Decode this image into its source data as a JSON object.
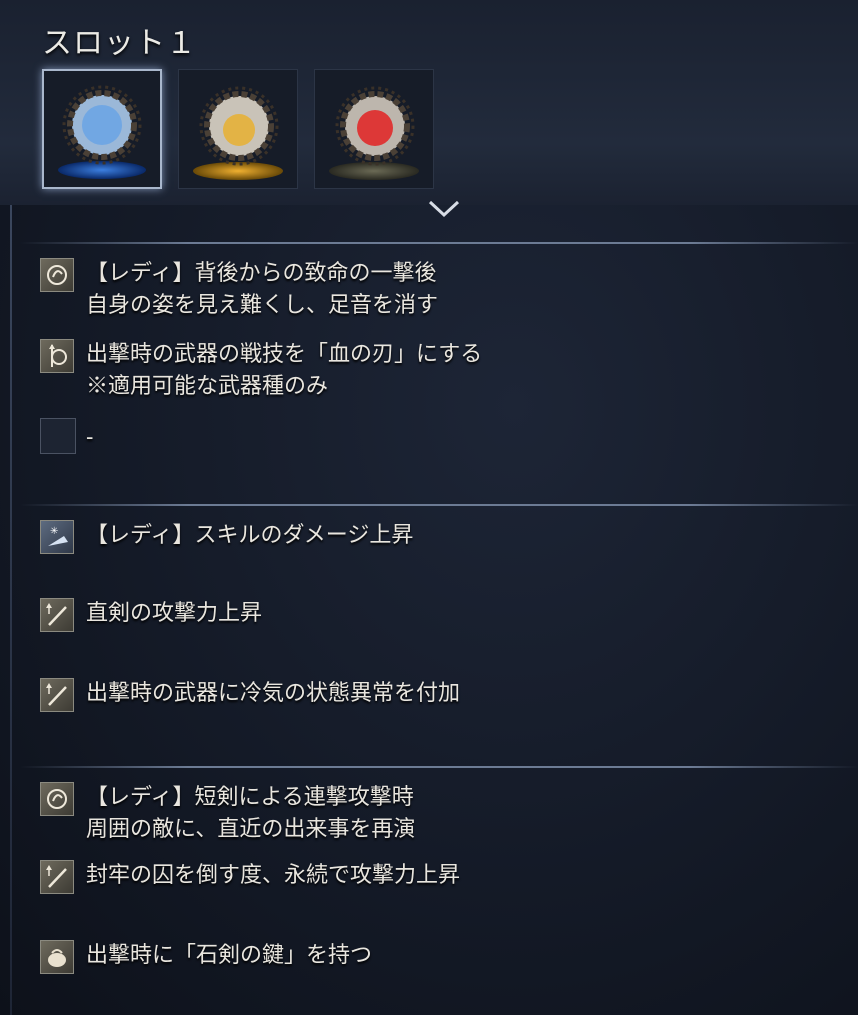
{
  "slot": {
    "title": "スロット１"
  },
  "vessels": [
    {
      "name": "blue-vessel-icon",
      "color": "#5fa0e8",
      "selected": true
    },
    {
      "name": "yellow-vessel-icon",
      "color": "#e8b030",
      "selected": false
    },
    {
      "name": "red-vessel-icon",
      "color": "#e02a2a",
      "selected": false
    }
  ],
  "groups": [
    {
      "effects": [
        {
          "icon": "relic-ring-icon",
          "line1": "【レディ】背後からの致命の一撃後",
          "line2": "自身の姿を見え難くし、足音を消す"
        },
        {
          "icon": "weapon-art-icon",
          "line1": "出撃時の武器の戦技を「血の刃」にする",
          "line2": "※適用可能な武器種のみ"
        },
        {
          "icon": "empty-slot",
          "line1": "-",
          "line2": ""
        }
      ]
    },
    {
      "effects": [
        {
          "icon": "skill-up-icon",
          "line1": "【レディ】スキルのダメージ上昇",
          "line2": ""
        },
        {
          "icon": "sword-up-icon",
          "line1": "直剣の攻撃力上昇",
          "line2": ""
        },
        {
          "icon": "sword-up-icon",
          "line1": "出撃時の武器に冷気の状態異常を付加",
          "line2": ""
        }
      ]
    },
    {
      "effects": [
        {
          "icon": "relic-ring-icon",
          "line1": "【レディ】短剣による連撃攻撃時",
          "line2": "周囲の敵に、直近の出来事を再演"
        },
        {
          "icon": "sword-up-icon",
          "line1": "封牢の囚を倒す度、永続で攻撃力上昇",
          "line2": ""
        },
        {
          "icon": "pouch-icon",
          "line1": "出撃時に「石剣の鍵」を持つ",
          "line2": ""
        }
      ]
    }
  ]
}
